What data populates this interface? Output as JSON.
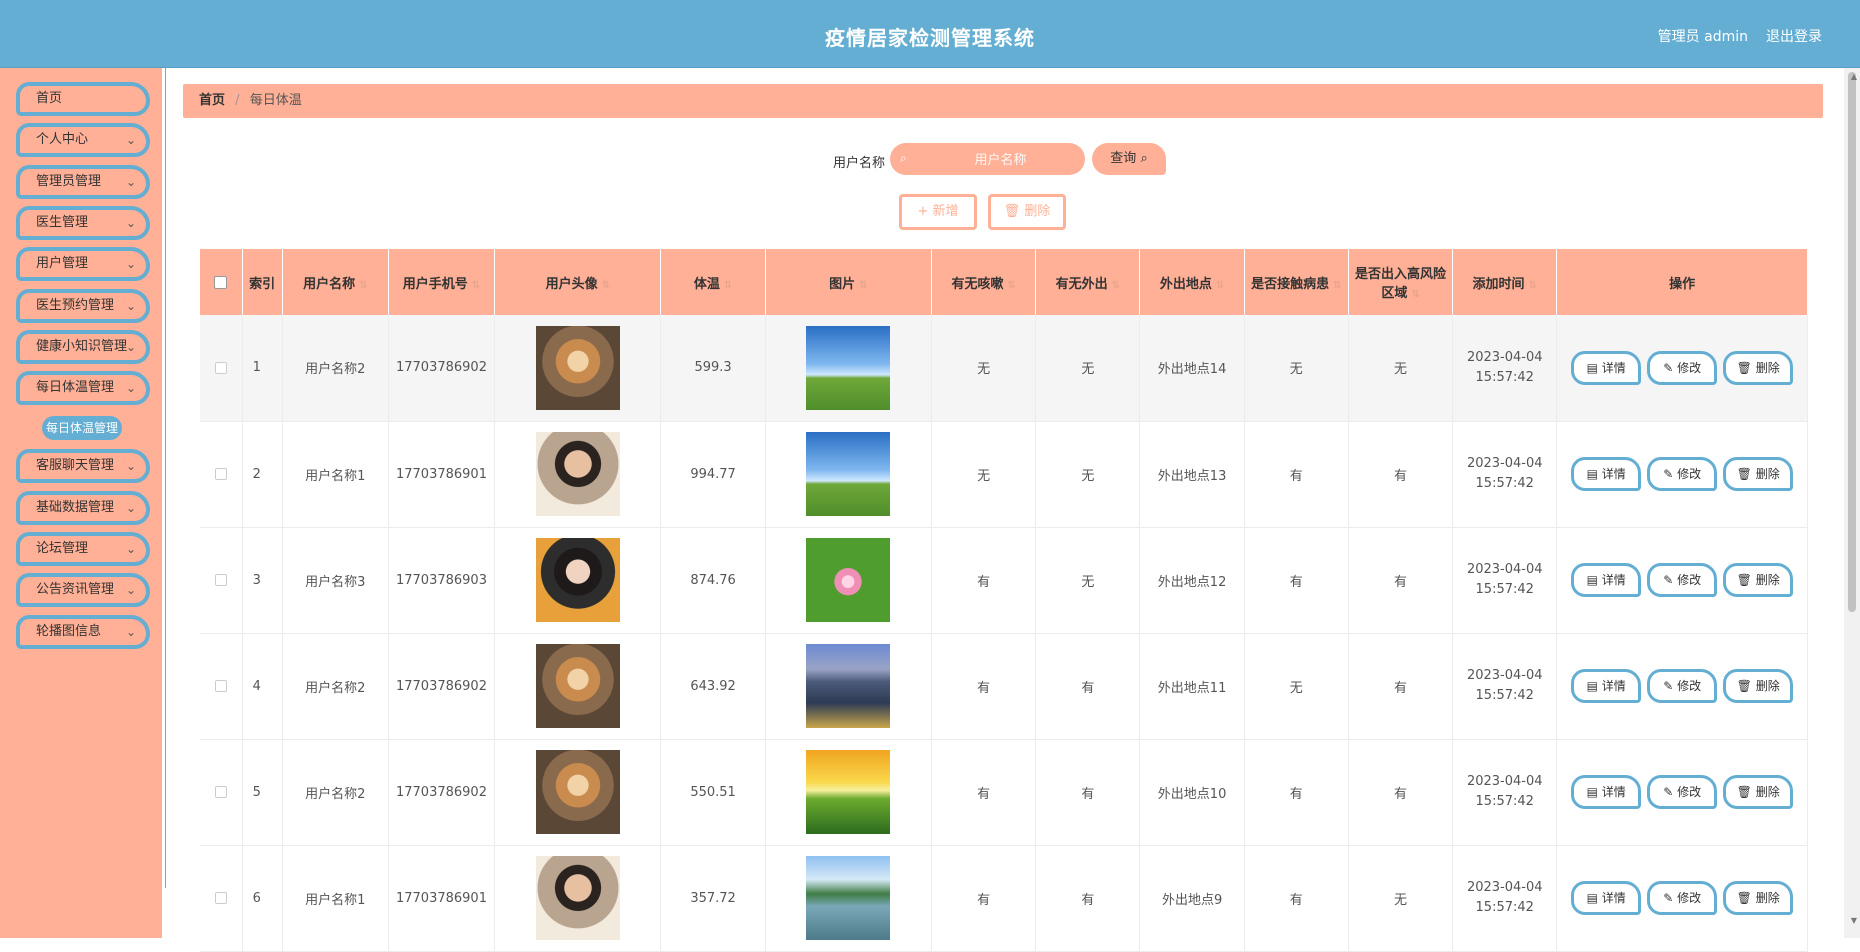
{
  "header": {
    "title": "疫情居家检测管理系统",
    "user": "管理员 admin",
    "logout": "退出登录"
  },
  "sidebar": {
    "items": [
      {
        "label": "首页",
        "chevron": false
      },
      {
        "label": "个人中心",
        "chevron": true
      },
      {
        "label": "管理员管理",
        "chevron": true
      },
      {
        "label": "医生管理",
        "chevron": true
      },
      {
        "label": "用户管理",
        "chevron": true
      },
      {
        "label": "医生预约管理",
        "chevron": true
      },
      {
        "label": "健康小知识管理",
        "chevron": true
      },
      {
        "label": "每日体温管理",
        "chevron": true
      },
      {
        "label": "客服聊天管理",
        "chevron": true
      },
      {
        "label": "基础数据管理",
        "chevron": true
      },
      {
        "label": "论坛管理",
        "chevron": true
      },
      {
        "label": "公告资讯管理",
        "chevron": true
      },
      {
        "label": "轮播图信息",
        "chevron": true
      }
    ],
    "active_sub": "每日体温管理"
  },
  "breadcrumb": {
    "home": "首页",
    "current": "每日体温"
  },
  "search": {
    "label": "用户名称",
    "placeholder": "用户名称",
    "query_label": "查询"
  },
  "actions": {
    "add_label": "+ 新增",
    "delete_label": "删除"
  },
  "table": {
    "headers": [
      "索引",
      "用户名称",
      "用户手机号",
      "用户头像",
      "体温",
      "图片",
      "有无咳嗽",
      "有无外出",
      "外出地点",
      "是否接触病患",
      "是否出入高风险区域",
      "添加时间",
      "操作"
    ],
    "rows": [
      {
        "idx": "1",
        "name": "用户名称2",
        "phone": "17703786902",
        "avatar": "dog",
        "temp": "599.3",
        "image": "sky",
        "cough": "无",
        "out": "无",
        "place": "外出地点14",
        "contact": "无",
        "risk": "无",
        "time": "2023-04-04 15:57:42"
      },
      {
        "idx": "2",
        "name": "用户名称1",
        "phone": "17703786901",
        "avatar": "boy",
        "temp": "994.77",
        "image": "sky",
        "cough": "无",
        "out": "无",
        "place": "外出地点13",
        "contact": "有",
        "risk": "有",
        "time": "2023-04-04 15:57:42"
      },
      {
        "idx": "3",
        "name": "用户名称3",
        "phone": "17703786903",
        "avatar": "girl",
        "temp": "874.76",
        "image": "lotus",
        "cough": "有",
        "out": "无",
        "place": "外出地点12",
        "contact": "有",
        "risk": "有",
        "time": "2023-04-04 15:57:42"
      },
      {
        "idx": "4",
        "name": "用户名称2",
        "phone": "17703786902",
        "avatar": "dog",
        "temp": "643.92",
        "image": "city",
        "cough": "有",
        "out": "有",
        "place": "外出地点11",
        "contact": "无",
        "risk": "有",
        "time": "2023-04-04 15:57:42"
      },
      {
        "idx": "5",
        "name": "用户名称2",
        "phone": "17703786902",
        "avatar": "dog",
        "temp": "550.51",
        "image": "sunset",
        "cough": "有",
        "out": "有",
        "place": "外出地点10",
        "contact": "有",
        "risk": "有",
        "time": "2023-04-04 15:57:42"
      },
      {
        "idx": "6",
        "name": "用户名称1",
        "phone": "17703786901",
        "avatar": "boy",
        "temp": "357.72",
        "image": "lake",
        "cough": "有",
        "out": "有",
        "place": "外出地点9",
        "contact": "有",
        "risk": "无",
        "time": "2023-04-04 15:57:42"
      }
    ],
    "op_labels": {
      "detail": "详情",
      "edit": "修改",
      "delete": "删除"
    }
  },
  "colors": {
    "header": "#63aed2",
    "accent": "#ffb096"
  }
}
